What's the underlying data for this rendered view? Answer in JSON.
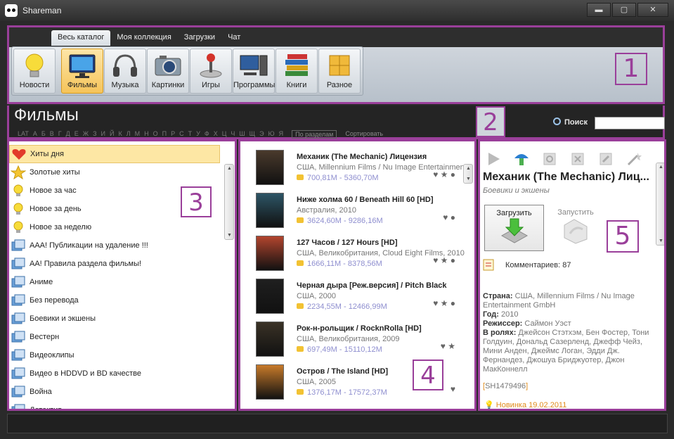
{
  "window": {
    "title": "Shareman",
    "minimize": "▬",
    "maximize": "▢",
    "close": "✕"
  },
  "tabs": [
    {
      "label": "Весь каталог",
      "active": true
    },
    {
      "label": "Моя коллекция",
      "active": false
    },
    {
      "label": "Загрузки",
      "active": false
    },
    {
      "label": "Чат",
      "active": false
    }
  ],
  "categories": [
    {
      "label": "Новости",
      "icon": "lightbulb-icon"
    },
    {
      "label": "Фильмы",
      "icon": "monitor-icon",
      "active": true
    },
    {
      "label": "Музыка",
      "icon": "headphones-icon"
    },
    {
      "label": "Картинки",
      "icon": "camera-icon"
    },
    {
      "label": "Игры",
      "icon": "joystick-icon"
    },
    {
      "label": "Программы",
      "icon": "computer-icon"
    },
    {
      "label": "Книги",
      "icon": "books-icon"
    },
    {
      "label": "Разное",
      "icon": "boxes-icon"
    }
  ],
  "annotations": [
    "1",
    "2",
    "3",
    "4",
    "5"
  ],
  "section": {
    "title": "Фильмы",
    "alphabet": [
      "LAT",
      "А",
      "Б",
      "В",
      "Г",
      "Д",
      "Е",
      "Ж",
      "З",
      "И",
      "Й",
      "К",
      "Л",
      "М",
      "Н",
      "О",
      "П",
      "Р",
      "С",
      "Т",
      "У",
      "Ф",
      "Х",
      "Ц",
      "Ч",
      "Ш",
      "Щ",
      "Э",
      "Ю",
      "Я"
    ],
    "by_section": "По разделам",
    "sort": "Сортировать",
    "search_label": "Поиск"
  },
  "category_list": [
    {
      "label": "Хиты дня",
      "icon": "heart-icon",
      "active": true
    },
    {
      "label": "Золотые хиты",
      "icon": "star-icon"
    },
    {
      "label": "Новое за час",
      "icon": "lightbulb-icon"
    },
    {
      "label": "Новое за день",
      "icon": "lightbulb-icon"
    },
    {
      "label": "Новое за неделю",
      "icon": "lightbulb-icon"
    },
    {
      "label": "AAA! Публикации на удаление !!!",
      "icon": "folder-icon"
    },
    {
      "label": "AA! Правила раздела фильмы!",
      "icon": "folder-icon"
    },
    {
      "label": "Аниме",
      "icon": "folder-icon"
    },
    {
      "label": "Без перевода",
      "icon": "folder-icon"
    },
    {
      "label": "Боевики и экшены",
      "icon": "folder-icon"
    },
    {
      "label": "Вестерн",
      "icon": "folder-icon"
    },
    {
      "label": "Видеоклипы",
      "icon": "folder-icon"
    },
    {
      "label": "Видео в HDDVD и BD качестве",
      "icon": "folder-icon"
    },
    {
      "label": "Война",
      "icon": "folder-icon"
    },
    {
      "label": "Детектив",
      "icon": "folder-icon"
    }
  ],
  "films": [
    {
      "title": "Механик (The Mechanic) Лицензия",
      "meta": "США, Millennium Films / Nu Image Entertainment",
      "size": "700,81M - 5360,70M",
      "poster": "#4a3a2c",
      "icons": "♥ ★ ●"
    },
    {
      "title": "Ниже холма 60 / Beneath Hill 60 [HD]",
      "meta": "Австралия, 2010",
      "size": "3624,60M - 9286,16M",
      "poster": "#2d5566",
      "icons": "♥ ●"
    },
    {
      "title": "127 Часов / 127 Hours [HD]",
      "meta": "США, Великобритания, Cloud Eight Films, 2010",
      "size": "1666,11M - 8378,56M",
      "poster": "#b2452e",
      "icons": "♥ ★ ●"
    },
    {
      "title": "Черная дыра [Реж.версия] / Pitch Black",
      "meta": "США, 2000",
      "size": "2234,55M - 12466,99M",
      "poster": "#1f1f1f",
      "icons": "♥ ★ ●"
    },
    {
      "title": "Рок-н-рольщик / RocknRolla  [HD]",
      "meta": "США, Великобритания, 2009",
      "size": "697,49M - 15110,12M",
      "poster": "#3a3226",
      "icons": "♥ ★"
    },
    {
      "title": "Остров / The Island [HD]",
      "meta": "США, 2005",
      "size": "1376,17M - 17572,37M",
      "poster": "#c77a2a",
      "icons": "♥"
    }
  ],
  "detail": {
    "title": "Механик (The Mechanic) Лиц...",
    "subtitle": "Боевики и экшены",
    "download": "Загрузить",
    "run": "Запустить",
    "comments": "Комментариев: 87",
    "country_label": "Страна:",
    "country": "США, Millennium Films / Nu Image Entertainment GmbH",
    "year_label": "Год:",
    "year": "2010",
    "director_label": "Режиссер:",
    "director": "Саймон Уэст",
    "cast_label": "В ролях:",
    "cast": "Джейсон Стэтхэм, Бен Фостер, Тони Голдуин, Дональд Сазерленд, Джефф Чейз, Мини Анден, Джеймс Логан, Эдди Дж. Фернандез, Джошуа Бриджуотер, Джон МакКоннелл",
    "sh_open": "[",
    "sh": "SH1479496",
    "sh_close": "]",
    "new": "Новинка 19.02.2011"
  },
  "colors": {
    "accent": "#9a3f9a",
    "highlight": "#fde7a4",
    "size_text": "#8e8ecf"
  }
}
